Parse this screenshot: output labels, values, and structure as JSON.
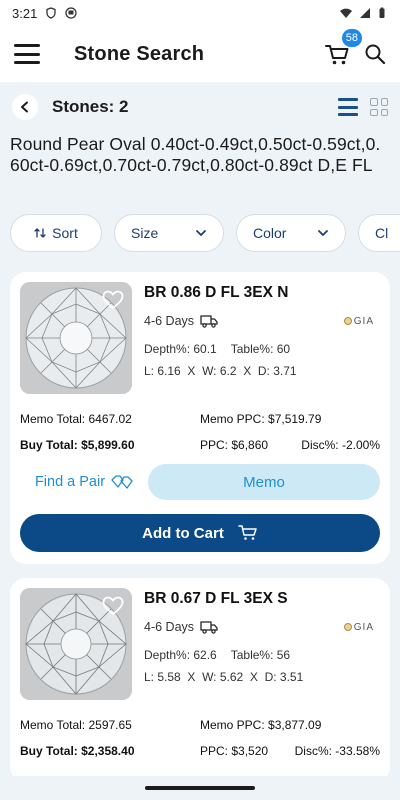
{
  "status_bar": {
    "time": "3:21"
  },
  "app_bar": {
    "title": "Stone Search",
    "cart_count": "58"
  },
  "sub_header": {
    "stones_label": "Stones: 2"
  },
  "criteria": "Round Pear Oval 0.40ct-0.49ct,0.50ct-0.59ct,0.60ct-0.69ct,0.70ct-0.79ct,0.80ct-0.89ct D,E FL",
  "filters": {
    "sort": "Sort",
    "size": "Size",
    "color": "Color",
    "more": "Cl"
  },
  "stones": [
    {
      "name": "BR 0.86 D FL 3EX N",
      "delivery": "4-6 Days",
      "lab": "GIA",
      "depth": "Depth%: 60.1",
      "table": "Table%: 60",
      "l": "L: 6.16",
      "w": "W: 6.2",
      "d": "D: 3.71",
      "x1": "X",
      "x2": "X",
      "memo_total": "Memo Total: 6467.02",
      "memo_ppc": "Memo PPC: $7,519.79",
      "buy_total": "Buy Total: $5,899.60",
      "ppc": "PPC: $6,860",
      "disc": "Disc%: -2.00%"
    },
    {
      "name": "BR 0.67 D FL 3EX S",
      "delivery": "4-6 Days",
      "lab": "GIA",
      "depth": "Depth%: 62.6",
      "table": "Table%: 56",
      "l": "L: 5.58",
      "w": "W: 5.62",
      "d": "D: 3.51",
      "x1": "X",
      "x2": "X",
      "memo_total": "Memo Total: 2597.65",
      "memo_ppc": "Memo PPC: $3,877.09",
      "buy_total": "Buy Total: $2,358.40",
      "ppc": "PPC: $3,520",
      "disc": "Disc%: -33.58%"
    }
  ],
  "card_actions": {
    "find_pair": "Find a Pair",
    "memo": "Memo",
    "add_to_cart": "Add to Cart"
  },
  "colors": {
    "primary": "#0b4a86",
    "accent": "#1f8ed4",
    "memo_bg": "#cde9f6",
    "page_bg": "#eef3f8"
  }
}
